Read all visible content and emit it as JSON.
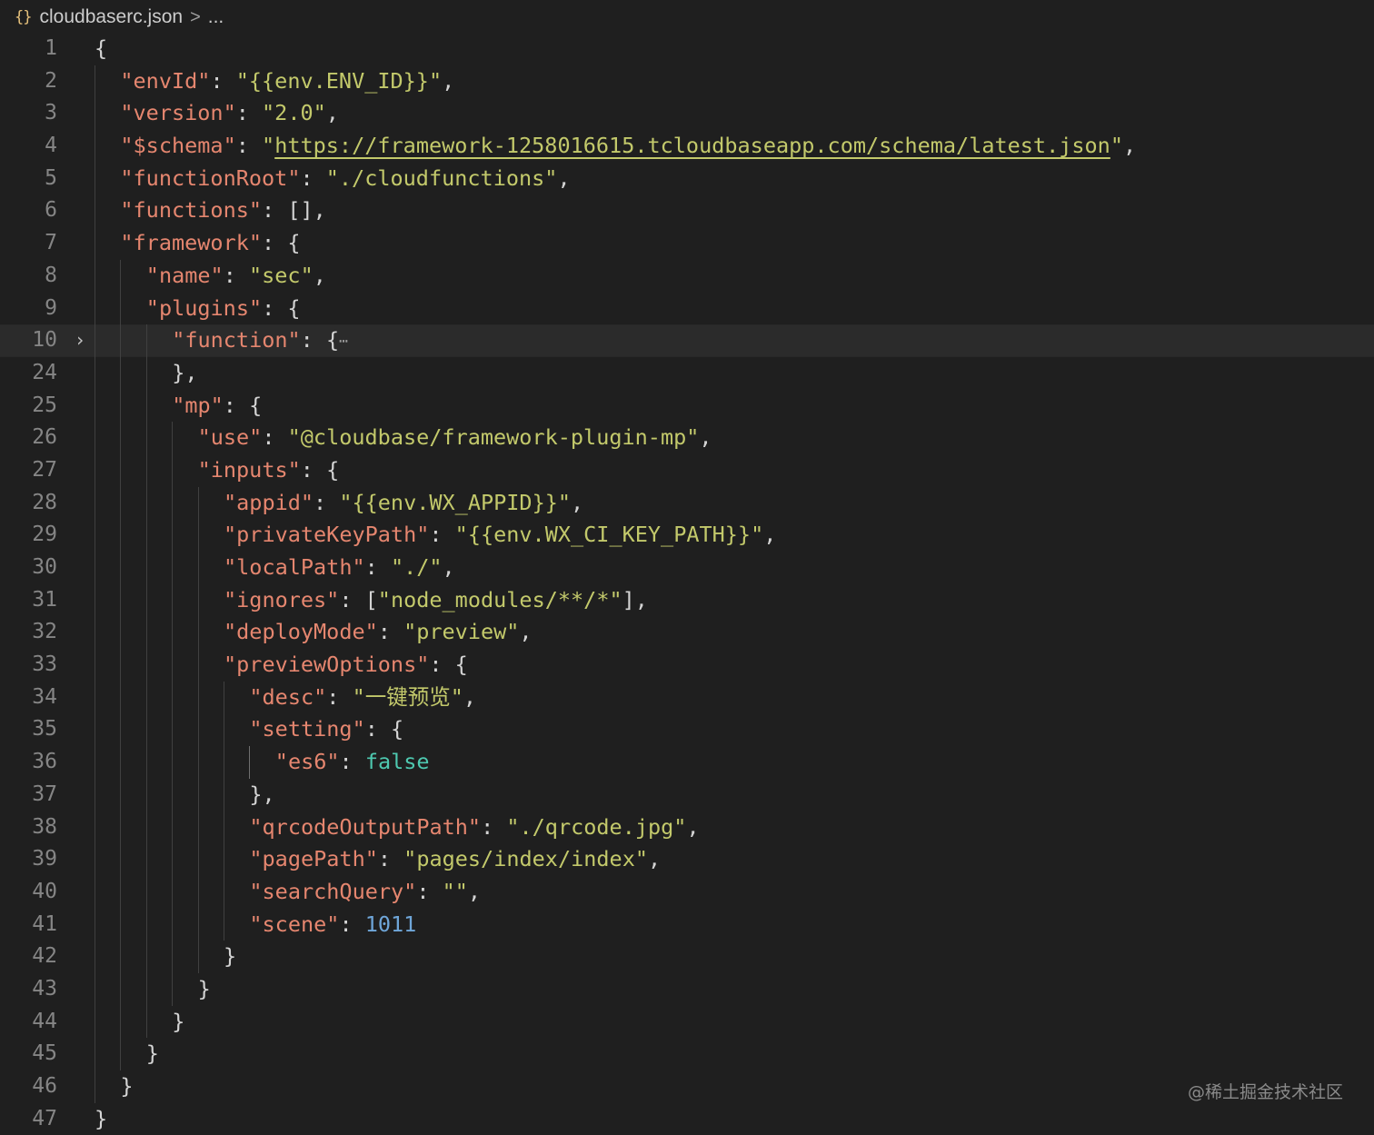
{
  "breadcrumb": {
    "icon": "json-braces-icon",
    "icon_glyph": "{}",
    "file": "cloudbaserc.json",
    "separator": ">",
    "more": "..."
  },
  "watermark": "@稀土掘金技术社区",
  "lines": [
    {
      "n": "1",
      "indent": 0,
      "tokens": [
        [
          "p",
          "{"
        ]
      ]
    },
    {
      "n": "2",
      "indent": 1,
      "tokens": [
        [
          "k",
          "\"envId\""
        ],
        [
          "p",
          ": "
        ],
        [
          "s",
          "\"{{env.ENV_ID}}\""
        ],
        [
          "p",
          ","
        ]
      ]
    },
    {
      "n": "3",
      "indent": 1,
      "tokens": [
        [
          "k",
          "\"version\""
        ],
        [
          "p",
          ": "
        ],
        [
          "s",
          "\"2.0\""
        ],
        [
          "p",
          ","
        ]
      ]
    },
    {
      "n": "4",
      "indent": 1,
      "tokens": [
        [
          "k",
          "\"$schema\""
        ],
        [
          "p",
          ": "
        ],
        [
          "s",
          "\""
        ],
        [
          "u",
          "https://framework-1258016615.tcloudbaseapp.com/schema/latest.json"
        ],
        [
          "s",
          "\""
        ],
        [
          "p",
          ","
        ]
      ]
    },
    {
      "n": "5",
      "indent": 1,
      "tokens": [
        [
          "k",
          "\"functionRoot\""
        ],
        [
          "p",
          ": "
        ],
        [
          "s",
          "\"./cloudfunctions\""
        ],
        [
          "p",
          ","
        ]
      ]
    },
    {
      "n": "6",
      "indent": 1,
      "tokens": [
        [
          "k",
          "\"functions\""
        ],
        [
          "p",
          ": [],"
        ]
      ]
    },
    {
      "n": "7",
      "indent": 1,
      "tokens": [
        [
          "k",
          "\"framework\""
        ],
        [
          "p",
          ": {"
        ]
      ]
    },
    {
      "n": "8",
      "indent": 2,
      "tokens": [
        [
          "k",
          "\"name\""
        ],
        [
          "p",
          ": "
        ],
        [
          "s",
          "\"sec\""
        ],
        [
          "p",
          ","
        ]
      ]
    },
    {
      "n": "9",
      "indent": 2,
      "tokens": [
        [
          "k",
          "\"plugins\""
        ],
        [
          "p",
          ": {"
        ]
      ]
    },
    {
      "n": "10",
      "indent": 3,
      "tokens": [
        [
          "k",
          "\"function\""
        ],
        [
          "p",
          ": {"
        ],
        [
          "e",
          "⋯"
        ]
      ],
      "folded": true,
      "highlight": true
    },
    {
      "n": "24",
      "indent": 3,
      "tokens": [
        [
          "p",
          "},"
        ]
      ]
    },
    {
      "n": "25",
      "indent": 3,
      "tokens": [
        [
          "k",
          "\"mp\""
        ],
        [
          "p",
          ": {"
        ]
      ]
    },
    {
      "n": "26",
      "indent": 4,
      "tokens": [
        [
          "k",
          "\"use\""
        ],
        [
          "p",
          ": "
        ],
        [
          "s",
          "\"@cloudbase/framework-plugin-mp\""
        ],
        [
          "p",
          ","
        ]
      ]
    },
    {
      "n": "27",
      "indent": 4,
      "tokens": [
        [
          "k",
          "\"inputs\""
        ],
        [
          "p",
          ": {"
        ]
      ]
    },
    {
      "n": "28",
      "indent": 5,
      "tokens": [
        [
          "k",
          "\"appid\""
        ],
        [
          "p",
          ": "
        ],
        [
          "s",
          "\"{{env.WX_APPID}}\""
        ],
        [
          "p",
          ","
        ]
      ]
    },
    {
      "n": "29",
      "indent": 5,
      "tokens": [
        [
          "k",
          "\"privateKeyPath\""
        ],
        [
          "p",
          ": "
        ],
        [
          "s",
          "\"{{env.WX_CI_KEY_PATH}}\""
        ],
        [
          "p",
          ","
        ]
      ]
    },
    {
      "n": "30",
      "indent": 5,
      "tokens": [
        [
          "k",
          "\"localPath\""
        ],
        [
          "p",
          ": "
        ],
        [
          "s",
          "\"./\""
        ],
        [
          "p",
          ","
        ]
      ]
    },
    {
      "n": "31",
      "indent": 5,
      "tokens": [
        [
          "k",
          "\"ignores\""
        ],
        [
          "p",
          ": ["
        ],
        [
          "s",
          "\"node_modules/**/*\""
        ],
        [
          "p",
          "],"
        ]
      ]
    },
    {
      "n": "32",
      "indent": 5,
      "tokens": [
        [
          "k",
          "\"deployMode\""
        ],
        [
          "p",
          ": "
        ],
        [
          "s",
          "\"preview\""
        ],
        [
          "p",
          ","
        ]
      ]
    },
    {
      "n": "33",
      "indent": 5,
      "tokens": [
        [
          "k",
          "\"previewOptions\""
        ],
        [
          "p",
          ": {"
        ]
      ]
    },
    {
      "n": "34",
      "indent": 6,
      "tokens": [
        [
          "k",
          "\"desc\""
        ],
        [
          "p",
          ": "
        ],
        [
          "s",
          "\"一键预览\""
        ],
        [
          "p",
          ","
        ]
      ]
    },
    {
      "n": "35",
      "indent": 6,
      "tokens": [
        [
          "k",
          "\"setting\""
        ],
        [
          "p",
          ": {"
        ]
      ]
    },
    {
      "n": "36",
      "indent": 7,
      "tokens": [
        [
          "k",
          "\"es6\""
        ],
        [
          "p",
          ": "
        ],
        [
          "b",
          "false"
        ]
      ]
    },
    {
      "n": "37",
      "indent": 6,
      "tokens": [
        [
          "p",
          "},"
        ]
      ]
    },
    {
      "n": "38",
      "indent": 6,
      "tokens": [
        [
          "k",
          "\"qrcodeOutputPath\""
        ],
        [
          "p",
          ": "
        ],
        [
          "s",
          "\"./qrcode.jpg\""
        ],
        [
          "p",
          ","
        ]
      ]
    },
    {
      "n": "39",
      "indent": 6,
      "tokens": [
        [
          "k",
          "\"pagePath\""
        ],
        [
          "p",
          ": "
        ],
        [
          "s",
          "\"pages/index/index\""
        ],
        [
          "p",
          ","
        ]
      ]
    },
    {
      "n": "40",
      "indent": 6,
      "tokens": [
        [
          "k",
          "\"searchQuery\""
        ],
        [
          "p",
          ": "
        ],
        [
          "s",
          "\"\""
        ],
        [
          "p",
          ","
        ]
      ]
    },
    {
      "n": "41",
      "indent": 6,
      "tokens": [
        [
          "k",
          "\"scene\""
        ],
        [
          "p",
          ": "
        ],
        [
          "n",
          "1011"
        ]
      ]
    },
    {
      "n": "42",
      "indent": 5,
      "tokens": [
        [
          "p",
          "}"
        ]
      ]
    },
    {
      "n": "43",
      "indent": 4,
      "tokens": [
        [
          "p",
          "}"
        ]
      ]
    },
    {
      "n": "44",
      "indent": 3,
      "tokens": [
        [
          "p",
          "}"
        ]
      ]
    },
    {
      "n": "45",
      "indent": 2,
      "tokens": [
        [
          "p",
          "}"
        ]
      ]
    },
    {
      "n": "46",
      "indent": 1,
      "tokens": [
        [
          "p",
          "}"
        ]
      ]
    },
    {
      "n": "47",
      "indent": 0,
      "tokens": [
        [
          "p",
          "}"
        ]
      ]
    }
  ]
}
